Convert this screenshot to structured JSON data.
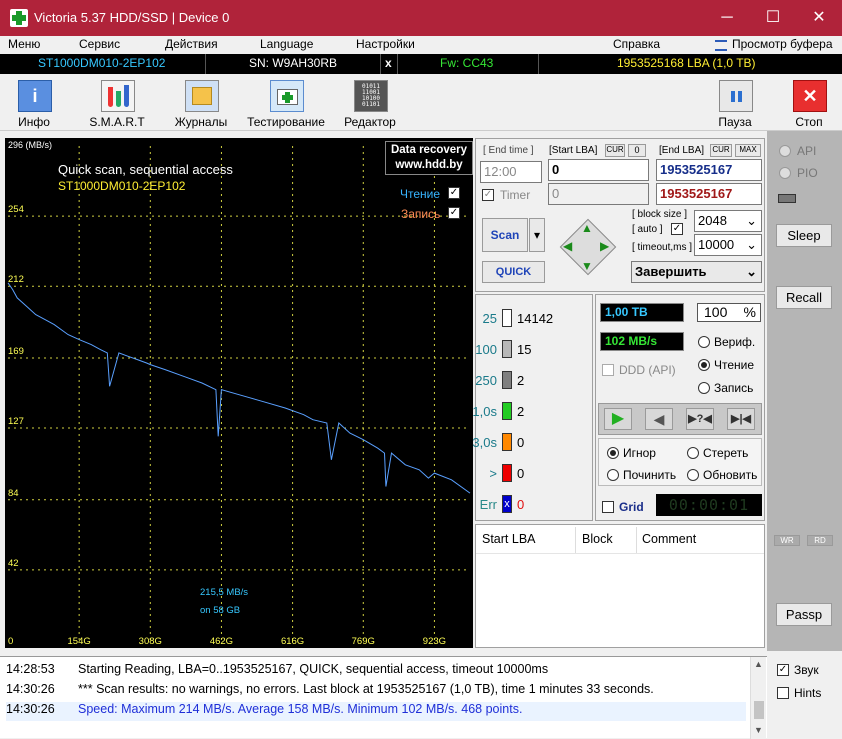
{
  "window": {
    "title": "Victoria 5.37 HDD/SSD | Device 0",
    "min": "─",
    "max": "☐",
    "close": "✕"
  },
  "menu": {
    "items": [
      "Меню",
      "Сервис",
      "Действия",
      "Language",
      "Настройки",
      "Справка"
    ],
    "buffer": "Просмотр буфера"
  },
  "infobar": {
    "model": "ST1000DM010-2EP102",
    "serial": "SN: W9AH30RB",
    "x": "x",
    "fw": "Fw: CC43",
    "lba": "1953525168 LBA (1,0 TB)"
  },
  "toolbar": {
    "info": "Инфо",
    "smart": "S.M.A.R.T",
    "logs": "Журналы",
    "test": "Тестирование",
    "editor": "Редактор",
    "pause": "Пауза",
    "stop": "Стоп"
  },
  "chart": {
    "title": "Quick scan, sequential access",
    "subtitle": "ST1000DM010-2EP102",
    "banner1": "Data recovery",
    "banner2": "www.hdd.by",
    "read": "Чтение",
    "write": "Запись",
    "speed_label": "215,5 MB/s",
    "pos_label": "on 58 GB"
  },
  "chart_data": {
    "type": "line",
    "xlabel": "",
    "ylabel": "",
    "y_unit": "296 (MB/s)",
    "ylim": [
      0,
      296
    ],
    "xlim": [
      0,
      1000
    ],
    "y_ticks": [
      "254",
      "212",
      "169",
      "127",
      "84",
      "42"
    ],
    "y_tick_values": [
      254,
      212,
      169,
      127,
      84,
      42
    ],
    "x_ticks": [
      "0",
      "154G",
      "308G",
      "462G",
      "616G",
      "769G",
      "923G"
    ],
    "x_tick_values": [
      0,
      154,
      308,
      462,
      616,
      769,
      923
    ],
    "series": [
      {
        "x": [
          0,
          10,
          20,
          40,
          60,
          80,
          100,
          130,
          154,
          180,
          200,
          215,
          220,
          240,
          260,
          280,
          300,
          308,
          340,
          380,
          420,
          450,
          455,
          462,
          500,
          550,
          600,
          640,
          660,
          690,
          700,
          716,
          740,
          769,
          800,
          815,
          818,
          830,
          860,
          890,
          910,
          923,
          960,
          1000
        ],
        "y": [
          214,
          210,
          205,
          200,
          195,
          192,
          189,
          183,
          180,
          177,
          174,
          172,
          152,
          172,
          170,
          168,
          166,
          165,
          162,
          158,
          154,
          150,
          122,
          150,
          147,
          143,
          139,
          135,
          132,
          130,
          108,
          130,
          124,
          120,
          115,
          112,
          92,
          112,
          105,
          102,
          97,
          100,
          96,
          88
        ]
      }
    ]
  },
  "end_time": {
    "label": "[ End time ]",
    "value": "12:00",
    "timer": "Timer"
  },
  "start_lba": {
    "label": "[Start LBA]",
    "cur": "CUR",
    "zero": "0",
    "value": "0",
    "value2": "0"
  },
  "end_lba": {
    "label": "[End LBA]",
    "cur": "CUR",
    "max": "MAX",
    "value": "1953525167",
    "value2": "1953525167"
  },
  "scan": {
    "scan": "Scan",
    "quick": "QUICK",
    "block_size": "[ block size ]",
    "auto": "[ auto ]",
    "timeout": "[ timeout,ms ]",
    "block_value": "2048",
    "timeout_value": "10000",
    "finish": "Завершить"
  },
  "stats": [
    {
      "t": "25",
      "count": "14142",
      "color": "#ffffff"
    },
    {
      "t": "100",
      "count": "15",
      "color": "#b8b8b8"
    },
    {
      "t": "250",
      "count": "2",
      "color": "#808080"
    },
    {
      "t": "1,0s",
      "count": "2",
      "color": "#22cc22"
    },
    {
      "t": "3,0s",
      "count": "0",
      "color": "#ff8800"
    },
    {
      "t": ">",
      "count": "0",
      "color": "#ee0000"
    },
    {
      "t": "Err",
      "count": "0",
      "color": "#0000cc"
    }
  ],
  "progress": {
    "size": "1,00 TB",
    "percent": "100",
    "pct_sign": "%",
    "speed": "102 MB/s",
    "verify": "Вериф.",
    "read": "Чтение",
    "write": "Запись",
    "ddd": "DDD (API)"
  },
  "actions": {
    "ignore": "Игнор",
    "erase": "Стереть",
    "repair": "Починить",
    "update": "Обновить",
    "grid": "Grid",
    "timer": "00:00:01"
  },
  "table": {
    "headers": [
      "Start LBA",
      "Block",
      "Comment"
    ]
  },
  "side": {
    "api": "API",
    "pio": "PIO",
    "sleep": "Sleep",
    "recall": "Recall",
    "wr": "WR",
    "rd": "RD",
    "passp": "Passp"
  },
  "log": [
    {
      "time": "14:28:53",
      "text": "Starting Reading, LBA=0..1953525167, QUICK, sequential access, timeout 10000ms",
      "color": "#000000"
    },
    {
      "time": "14:30:26",
      "text": "*** Scan results: no warnings, no errors. Last block at 1953525167 (1,0 TB), time 1 minutes 33 seconds.",
      "color": "#000000"
    },
    {
      "time": "14:30:26",
      "text": "Speed: Maximum 214 MB/s. Average 158 MB/s. Minimum 102 MB/s. 468 points.",
      "color": "#1f2fd8"
    }
  ],
  "sound": {
    "sound": "Звук",
    "hints": "Hints"
  }
}
